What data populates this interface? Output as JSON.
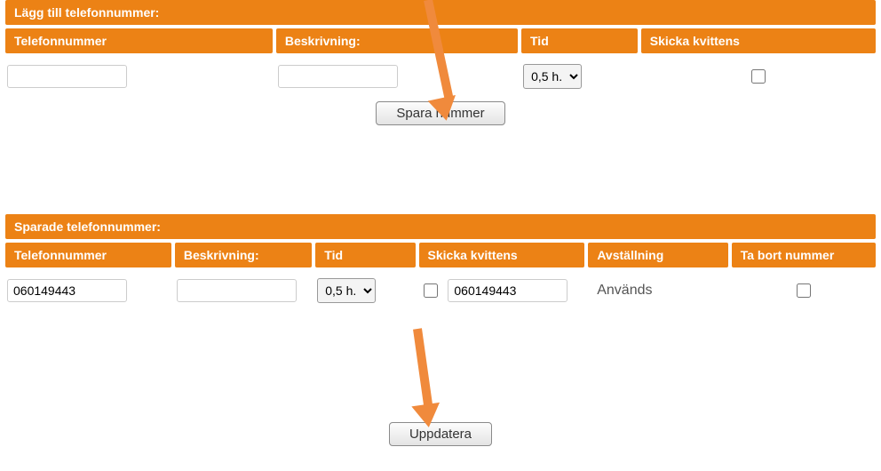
{
  "add_section": {
    "title": "Lägg till telefonnummer:",
    "headers": {
      "phone": "Telefonnummer",
      "desc": "Beskrivning:",
      "time": "Tid",
      "receipt": "Skicka kvittens"
    },
    "values": {
      "phone": "",
      "desc": "",
      "time_selected": "0,5 h.",
      "receipt_checked": false
    },
    "button": "Spara nummer"
  },
  "saved_section": {
    "title": "Sparade telefonnummer:",
    "headers": {
      "phone": "Telefonnummer",
      "desc": "Beskrivning:",
      "time": "Tid",
      "receipt": "Skicka kvittens",
      "status": "Avställning",
      "remove": "Ta bort nummer"
    },
    "rows": [
      {
        "phone": "060149443",
        "desc": "",
        "time_selected": "0,5 h.",
        "receipt_checked": false,
        "receipt_value": "060149443",
        "status": "Används",
        "remove_checked": false
      }
    ],
    "button": "Uppdatera"
  },
  "time_options": [
    "0,5 h."
  ]
}
